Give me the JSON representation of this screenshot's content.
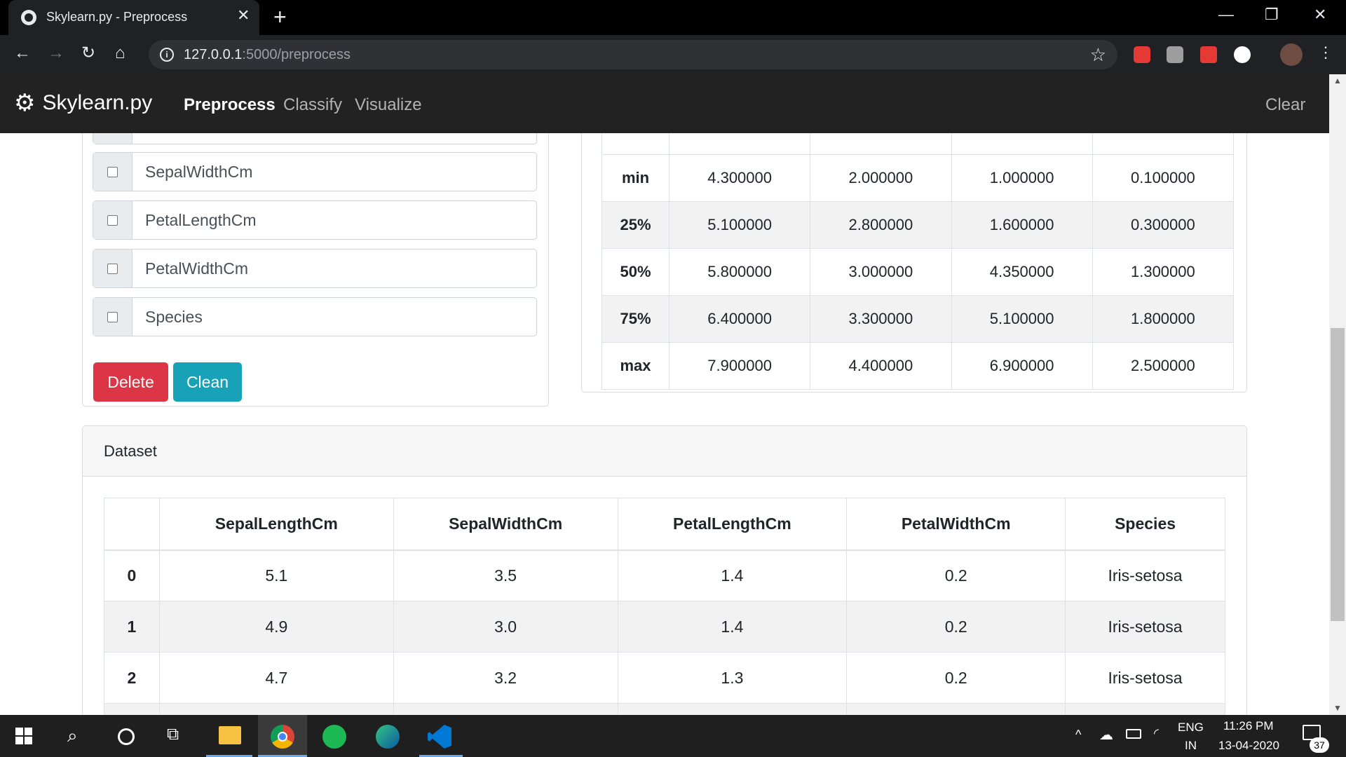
{
  "browser": {
    "tab_title": "Skylearn.py - Preprocess",
    "tab_close": "✕",
    "new_tab": "+",
    "url_host": "127.0.0.1",
    "url_path": ":5000/preprocess",
    "window_controls": [
      "—",
      "❐",
      "✕"
    ]
  },
  "navbar": {
    "brand": "Skylearn.py",
    "links": [
      "Preprocess",
      "Classify",
      "Visualize"
    ],
    "active": "Preprocess",
    "clear": "Clear"
  },
  "columns_panel": {
    "items": [
      "SepalWidthCm",
      "PetalLengthCm",
      "PetalWidthCm",
      "Species"
    ],
    "delete_label": "Delete",
    "clean_label": "Clean",
    "delete_color": "#dc3545",
    "clean_color": "#17a2b8"
  },
  "stats": {
    "rows": [
      {
        "label": "min",
        "values": [
          "4.300000",
          "2.000000",
          "1.000000",
          "0.100000"
        ]
      },
      {
        "label": "25%",
        "values": [
          "5.100000",
          "2.800000",
          "1.600000",
          "0.300000"
        ]
      },
      {
        "label": "50%",
        "values": [
          "5.800000",
          "3.000000",
          "4.350000",
          "1.300000"
        ]
      },
      {
        "label": "75%",
        "values": [
          "6.400000",
          "3.300000",
          "5.100000",
          "1.800000"
        ]
      },
      {
        "label": "max",
        "values": [
          "7.900000",
          "4.400000",
          "6.900000",
          "2.500000"
        ]
      }
    ]
  },
  "dataset": {
    "title": "Dataset",
    "headers": [
      "",
      "SepalLengthCm",
      "SepalWidthCm",
      "PetalLengthCm",
      "PetalWidthCm",
      "Species"
    ],
    "rows": [
      [
        "0",
        "5.1",
        "3.5",
        "1.4",
        "0.2",
        "Iris-setosa"
      ],
      [
        "1",
        "4.9",
        "3.0",
        "1.4",
        "0.2",
        "Iris-setosa"
      ],
      [
        "2",
        "4.7",
        "3.2",
        "1.3",
        "0.2",
        "Iris-setosa"
      ]
    ]
  },
  "taskbar": {
    "lang_line1": "ENG",
    "lang_line2": "IN",
    "time": "11:26 PM",
    "date": "13-04-2020",
    "notification_count": "37"
  }
}
